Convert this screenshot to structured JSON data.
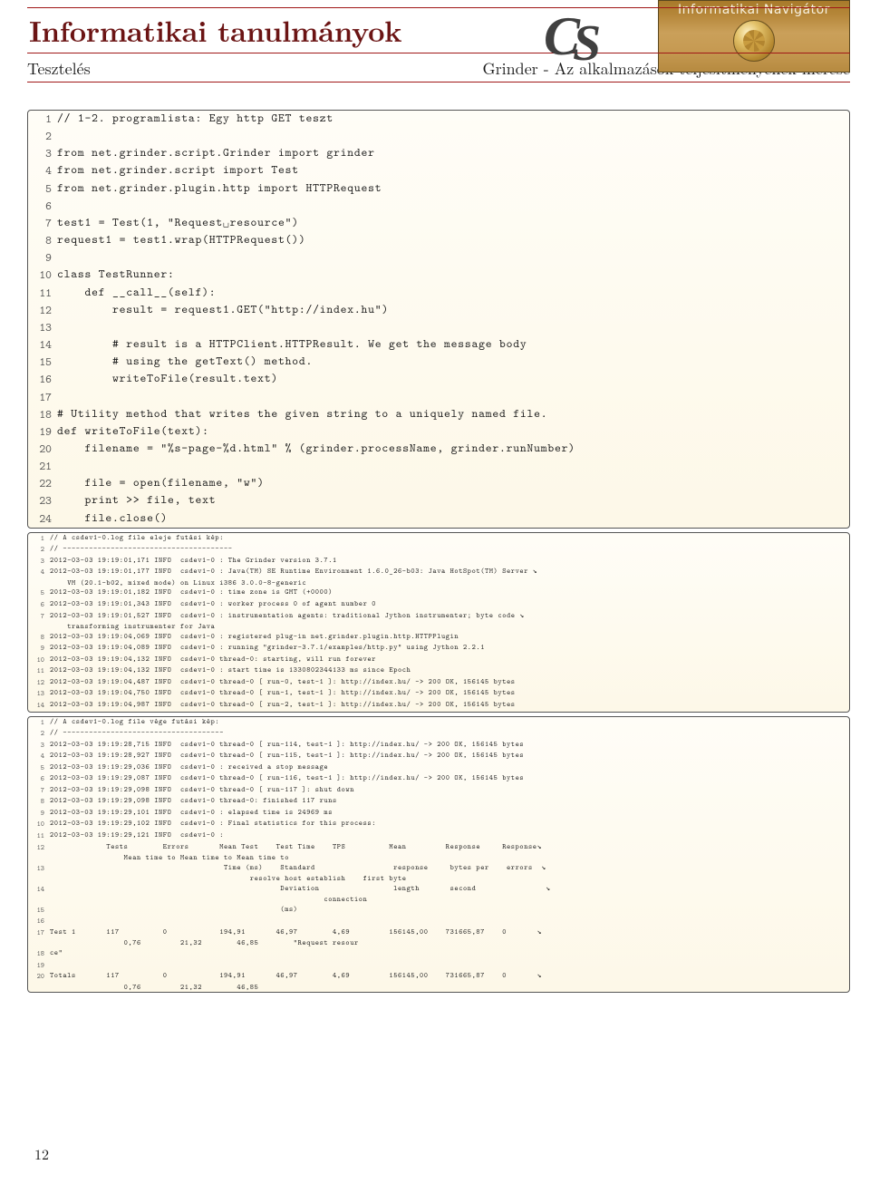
{
  "header": {
    "nav_banner": "Informatikai Navigátor",
    "title": "Informatikai tanulmányok",
    "subtitle_left": "Tesztelés",
    "subtitle_right": "Grinder - Az alkalmazások teljesítményének mérése"
  },
  "page_number": "12",
  "listings": [
    {
      "size": "big",
      "lines": [
        "// 1-2. programlista: Egy http GET teszt",
        "",
        "from net.grinder.script.Grinder import grinder",
        "from net.grinder.script import Test",
        "from net.grinder.plugin.http import HTTPRequest",
        "",
        "test1 = Test(1, \"Request␣resource\")",
        "request1 = test1.wrap(HTTPRequest())",
        "",
        "class TestRunner:",
        "    def __call__(self):",
        "        result = request1.GET(\"http://index.hu\")",
        "",
        "        # result is a HTTPClient.HTTPResult. We get the message body",
        "        # using the getText() method.",
        "        writeToFile(result.text)",
        "",
        "# Utility method that writes the given string to a uniquely named file.",
        "def writeToFile(text):",
        "    filename = \"%s-page-%d.html\" % (grinder.processName, grinder.runNumber)",
        "",
        "    file = open(filename, \"w\")",
        "    print >> file, text",
        "    file.close()"
      ]
    },
    {
      "size": "small",
      "lines": [
        "// A csdev1-0.log file eleje futási kép:",
        "// ---------------------------------------",
        "2012-03-03 19:19:01,171 INFO  csdev1-0 : The Grinder version 3.7.1",
        "2012-03-03 19:19:01,177 INFO  csdev1-0 : Java(TM) SE Runtime Environment 1.6.0_26-b03: Java HotSpot(TM) Server ↘\n    VM (20.1-b02, mixed mode) on Linux i386 3.0.0-8-generic",
        "2012-03-03 19:19:01,182 INFO  csdev1-0 : time zone is GMT (+0000)",
        "2012-03-03 19:19:01,343 INFO  csdev1-0 : worker process 0 of agent number 0",
        "2012-03-03 19:19:01,527 INFO  csdev1-0 : instrumentation agents: traditional Jython instrumenter; byte code ↘\n    transforming instrumenter for Java",
        "2012-03-03 19:19:04,069 INFO  csdev1-0 : registered plug-in net.grinder.plugin.http.HTTPPlugin",
        "2012-03-03 19:19:04,089 INFO  csdev1-0 : running \"grinder-3.7.1/examples/http.py\" using Jython 2.2.1",
        "2012-03-03 19:19:04,132 INFO  csdev1-0 thread-0: starting, will run forever",
        "2012-03-03 19:19:04,132 INFO  csdev1-0 : start time is 1330802344133 ms since Epoch",
        "2012-03-03 19:19:04,487 INFO  csdev1-0 thread-0 [ run-0, test-1 ]: http://index.hu/ -> 200 OK, 156145 bytes",
        "2012-03-03 19:19:04,750 INFO  csdev1-0 thread-0 [ run-1, test-1 ]: http://index.hu/ -> 200 OK, 156145 bytes",
        "2012-03-03 19:19:04,987 INFO  csdev1-0 thread-0 [ run-2, test-1 ]: http://index.hu/ -> 200 OK, 156145 bytes"
      ]
    },
    {
      "size": "small",
      "lines": [
        "// A csdev1-0.log file vége futási kép:",
        "// -------------------------------------",
        "2012-03-03 19:19:28,715 INFO  csdev1-0 thread-0 [ run-114, test-1 ]: http://index.hu/ -> 200 OK, 156145 bytes",
        "2012-03-03 19:19:28,927 INFO  csdev1-0 thread-0 [ run-115, test-1 ]: http://index.hu/ -> 200 OK, 156145 bytes",
        "2012-03-03 19:19:29,036 INFO  csdev1-0 : received a stop message",
        "2012-03-03 19:19:29,087 INFO  csdev1-0 thread-0 [ run-116, test-1 ]: http://index.hu/ -> 200 OK, 156145 bytes",
        "2012-03-03 19:19:29,098 INFO  csdev1-0 thread-0 [ run-117 ]: shut down",
        "2012-03-03 19:19:29,098 INFO  csdev1-0 thread-0: finished 117 runs",
        "2012-03-03 19:19:29,101 INFO  csdev1-0 : elapsed time is 24969 ms",
        "2012-03-03 19:19:29,102 INFO  csdev1-0 : Final statistics for this process:",
        "2012-03-03 19:19:29,121 INFO  csdev1-0 :",
        "             Tests        Errors       Mean Test    Test Time    TPS          Mean         Response     Response↘\n                 Mean time to Mean time to Mean time to",
        "                                        Time (ms)    Standard                  response     bytes per    errors  ↘\n                                              resolve host establish    first byte",
        "                                                     Deviation                 length       second                ↘\n                                                               connection",
        "                                                     (ms)",
        "",
        "Test 1       117          0            194,91       46,97        4,69         156145,00    731665,87    0       ↘\n                 0,76         21,32        46,85        \"Request resour",
        "ce\"",
        "",
        "Totals       117          0            194,91       46,97        4,69         156145,00    731665,87    0       ↘\n                 0,76         21,32        46,85"
      ]
    }
  ]
}
